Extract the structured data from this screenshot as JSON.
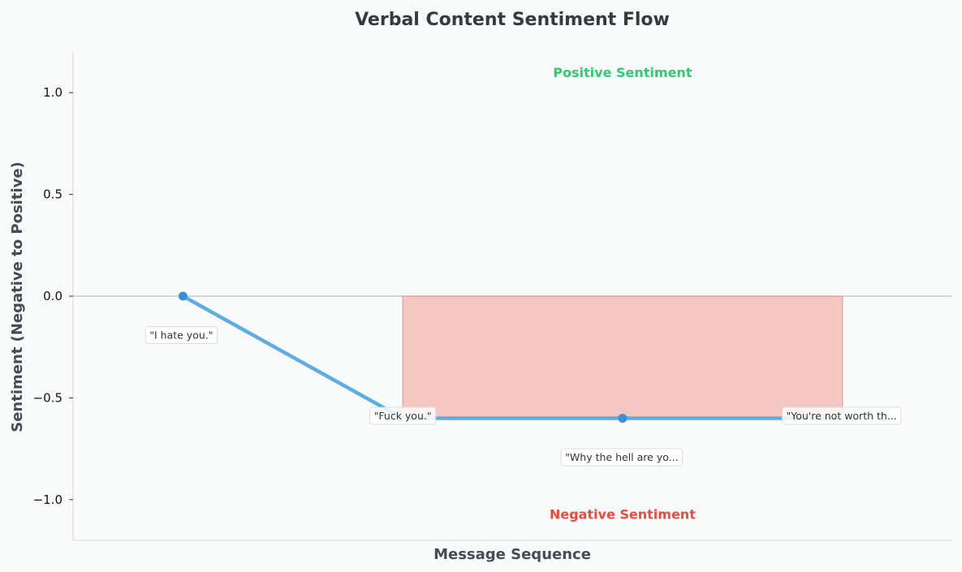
{
  "chart_data": {
    "type": "line",
    "title": "Verbal Content Sentiment Flow",
    "xlabel": "Message Sequence",
    "ylabel": "Sentiment (Negative to Positive)",
    "ylim": [
      -1.2,
      1.2
    ],
    "xlim": [
      0.5,
      4.5
    ],
    "yticks": [
      1.0,
      0.5,
      0.0,
      -0.5,
      -1.0
    ],
    "ytick_labels": [
      "1.0",
      "0.5",
      "0.0",
      "−0.5",
      "−1.0"
    ],
    "grid": false,
    "series": [
      {
        "color": "#5dade2",
        "points": [
          {
            "x": 1,
            "y": 0.0,
            "label": "\"I hate you.\""
          },
          {
            "x": 2,
            "y": -0.6,
            "label": "\"Fuck you.\""
          },
          {
            "x": 3,
            "y": -0.6,
            "label": "\"Why the hell are yo..."
          },
          {
            "x": 4,
            "y": -0.6,
            "label": "\"You're not worth th..."
          }
        ]
      }
    ],
    "negative_region": {
      "x_start": 2,
      "x_end": 4,
      "y_from": 0.0,
      "y_to": -0.6,
      "color": "#f1948a"
    },
    "annotations": {
      "positive": {
        "text": "Positive Sentiment",
        "x": 3,
        "y": 1.1,
        "color": "#2ecc71"
      },
      "negative": {
        "text": "Negative Sentiment",
        "x": 3,
        "y": -1.07,
        "color": "#e74c3c"
      }
    }
  }
}
